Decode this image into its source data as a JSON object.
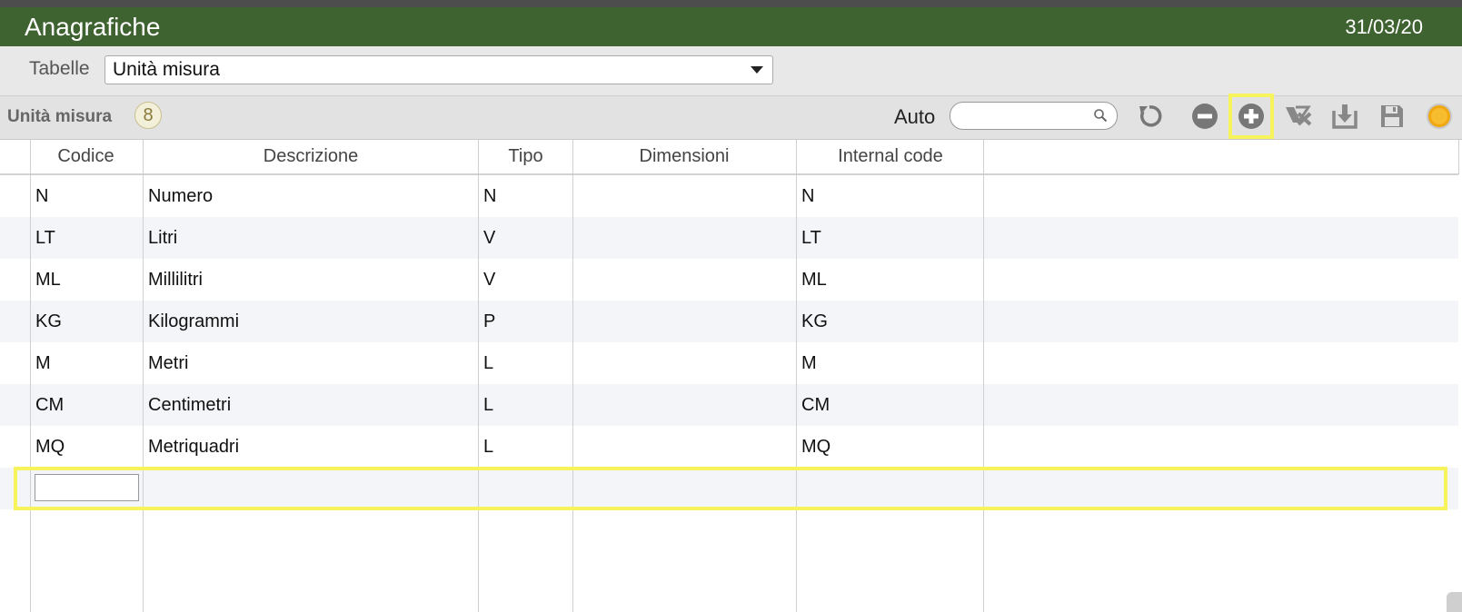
{
  "header": {
    "title": "Anagrafiche",
    "date": "31/03/20"
  },
  "table_selector": {
    "label": "Tabelle",
    "selected": "Unità misura"
  },
  "toolbar": {
    "section_title": "Unità misura",
    "count": "8",
    "search_label": "Auto",
    "search_value": "",
    "icons": [
      "refresh-icon",
      "remove-icon",
      "add-icon",
      "delete-icon",
      "download-icon",
      "save-icon",
      "status-icon"
    ]
  },
  "grid": {
    "columns": [
      "Codice",
      "Descrizione",
      "Tipo",
      "Dimensioni",
      "Internal code"
    ],
    "rows": [
      {
        "codice": "N",
        "descrizione": "Numero",
        "tipo": "N",
        "dimensioni": "",
        "internal": "N"
      },
      {
        "codice": "LT",
        "descrizione": "Litri",
        "tipo": "V",
        "dimensioni": "",
        "internal": "LT"
      },
      {
        "codice": "ML",
        "descrizione": "Millilitri",
        "tipo": "V",
        "dimensioni": "",
        "internal": "ML"
      },
      {
        "codice": "KG",
        "descrizione": "Kilogrammi",
        "tipo": "P",
        "dimensioni": "",
        "internal": "KG"
      },
      {
        "codice": "M",
        "descrizione": "Metri",
        "tipo": "L",
        "dimensioni": "",
        "internal": "M"
      },
      {
        "codice": "CM",
        "descrizione": "Centimetri",
        "tipo": "L",
        "dimensioni": "",
        "internal": "CM"
      },
      {
        "codice": "MQ",
        "descrizione": "Metriquadri",
        "tipo": "L",
        "dimensioni": "",
        "internal": "MQ"
      }
    ],
    "new_row_value": ""
  },
  "colors": {
    "title_bar": "#3f6330",
    "highlight": "#f7f35a"
  }
}
